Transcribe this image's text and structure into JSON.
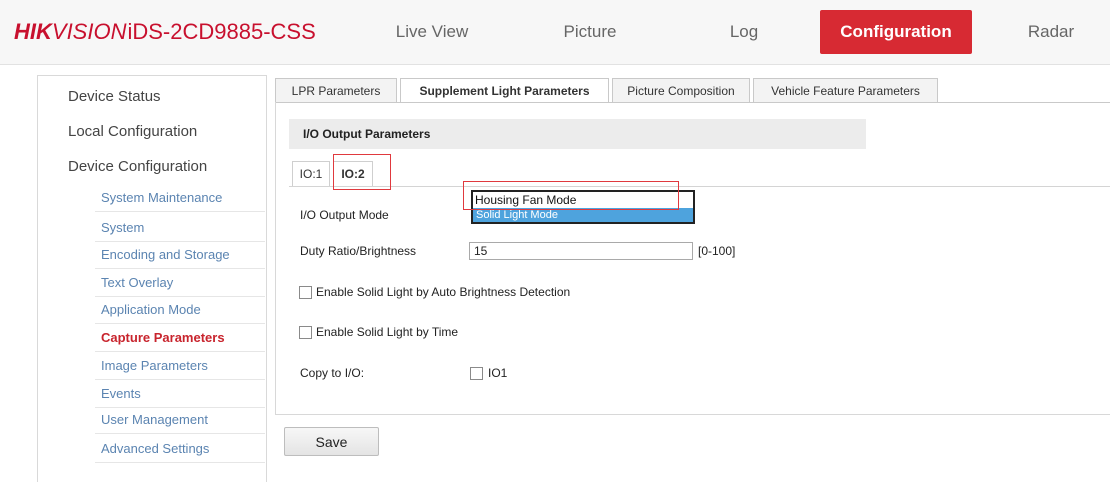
{
  "header": {
    "brand_hik": "HIK",
    "brand_vision": "VISION",
    "model": "iDS-2CD9885-CSS",
    "nav": [
      "Live View",
      "Picture",
      "Log",
      "Configuration",
      "Radar"
    ]
  },
  "sidebar": {
    "top_items": [
      "Device Status",
      "Local Configuration",
      "Device Configuration"
    ],
    "sub_items": [
      "System Maintenance",
      "System",
      "Encoding and Storage",
      "Text Overlay",
      "Application Mode",
      "Capture Parameters",
      "Image Parameters",
      "Events",
      "User Management",
      "Advanced Settings"
    ],
    "active": "Capture Parameters"
  },
  "tabs": [
    "LPR Parameters",
    "Supplement Light Parameters",
    "Picture Composition",
    "Vehicle Feature Parameters"
  ],
  "section": {
    "title": "I/O Output Parameters",
    "io_tabs": [
      "IO:1",
      "IO:2"
    ]
  },
  "form": {
    "mode_label": "I/O Output Mode",
    "mode_options": [
      "Housing Fan Mode",
      "Solid Light Mode"
    ],
    "duty_label": "Duty Ratio/Brightness",
    "duty_value": "15",
    "duty_range": "[0-100]",
    "auto_brightness_label": "Enable Solid Light by Auto Brightness Detection",
    "by_time_label": "Enable Solid Light by Time",
    "copy_label": "Copy to I/O:",
    "copy_option": "IO1"
  },
  "save_label": "Save",
  "colors": {
    "accent": "#d72a33",
    "link": "#5b84b1",
    "active_link": "#c8242d",
    "select_highlight": "#4ea3dd"
  }
}
